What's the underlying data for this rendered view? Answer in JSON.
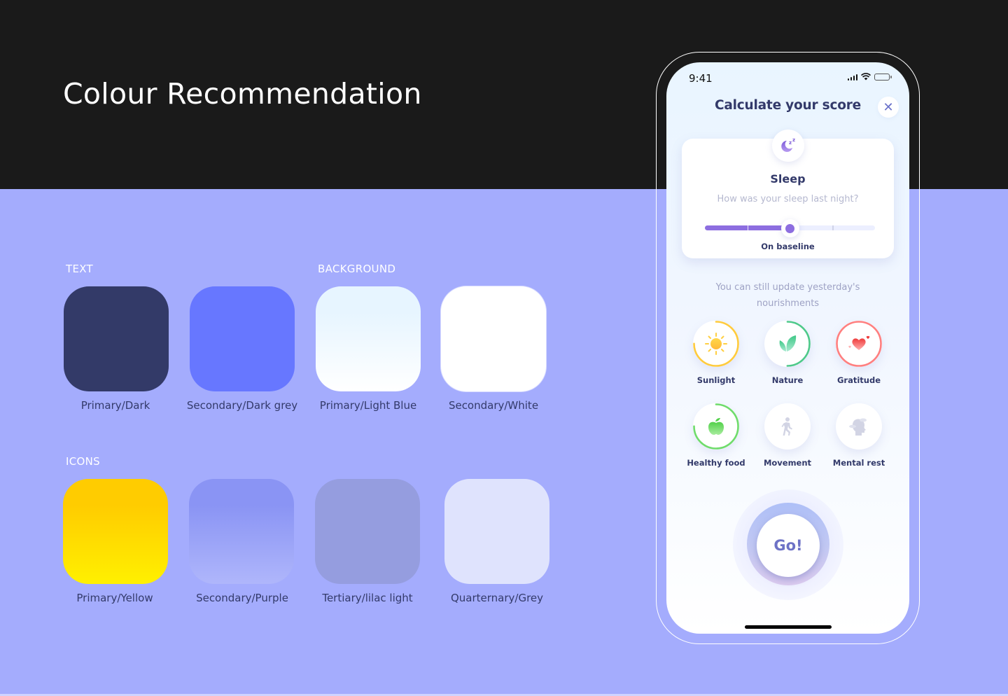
{
  "page": {
    "title": "Colour Recommendation"
  },
  "sections": {
    "text_label": "TEXT",
    "background_label": "BACKGROUND",
    "icons_label": "ICONS"
  },
  "swatches": {
    "text": [
      {
        "label": "Primary/Dark",
        "color": "#333a68"
      },
      {
        "label": "Secondary/Dark grey",
        "color": "#6777ff"
      }
    ],
    "background": [
      {
        "label": "Primary/Light Blue",
        "color_top": "#e7f5ff",
        "color_bottom": "#ffffff"
      },
      {
        "label": "Secondary/White",
        "color": "#ffffff"
      }
    ],
    "icons": [
      {
        "label": "Primary/Yellow",
        "color_top": "#ffcc00",
        "color_bottom": "#fff000"
      },
      {
        "label": "Secondary/Purple",
        "color_top": "#8a94f4",
        "color_bottom": "#afb6fb"
      },
      {
        "label": "Tertiary/lilac light",
        "color": "#959ddf"
      },
      {
        "label": "Quarternary/Grey",
        "color": "#dfe3fd"
      }
    ]
  },
  "phone": {
    "status_time": "9:41",
    "screen_title": "Calculate your score",
    "close_icon": "close-icon",
    "sleep_card": {
      "icon": "moon-zzz-icon",
      "title": "Sleep",
      "question": "How was your sleep last night?",
      "slider_value_fraction": 0.5,
      "slider_caption": "On baseline"
    },
    "update_text": "You can still update yesterday's nourishments",
    "habits": [
      {
        "label": "Sunlight",
        "icon": "sun-icon",
        "progress": 0.75,
        "ring_color": "#ffcb3d"
      },
      {
        "label": "Nature",
        "icon": "leaf-icon",
        "progress": 0.5,
        "ring_color": "#4ec98a"
      },
      {
        "label": "Gratitude",
        "icon": "hearts-icon",
        "progress": 1.0,
        "ring_color": "#ff7f7f"
      },
      {
        "label": "Healthy food",
        "icon": "apple-icon",
        "progress": 0.75,
        "ring_color": "#6fdc6b"
      },
      {
        "label": "Movement",
        "icon": "walking-icon",
        "progress": 0,
        "ring_color": "#d0d3e6"
      },
      {
        "label": "Mental rest",
        "icon": "head-clouds-icon",
        "progress": 0,
        "ring_color": "#d0d3e6"
      }
    ],
    "go_button_label": "Go!"
  },
  "colors": {
    "band_dark": "#1a1a1a",
    "canvas_lilac": "#a4acfd",
    "primary_dark_text": "#333a6a",
    "accent_purple": "#8d6ee0"
  }
}
